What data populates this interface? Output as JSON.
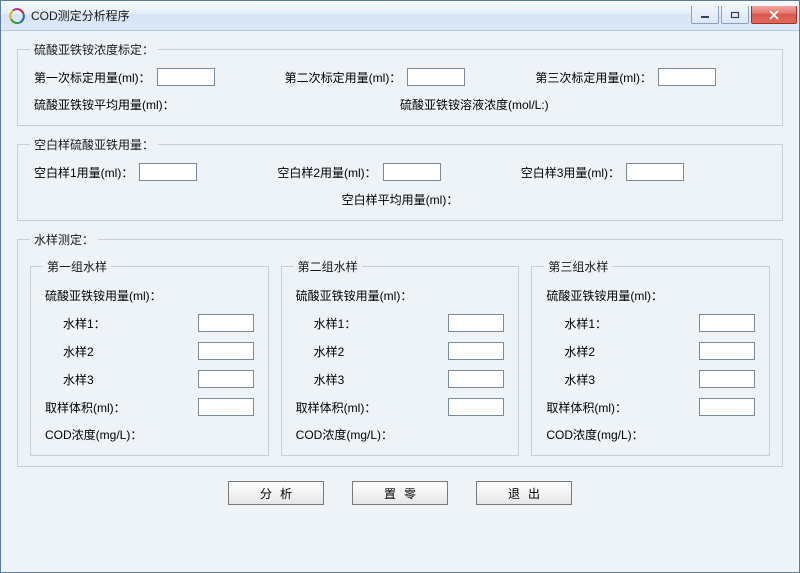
{
  "window": {
    "title": "COD测定分析程序"
  },
  "calibration": {
    "legend": "硫酸亚铁铵浓度标定：",
    "cal1_label": "第一次标定用量(ml)：",
    "cal1_value": "",
    "cal2_label": "第二次标定用量(ml)：",
    "cal2_value": "",
    "cal3_label": "第三次标定用量(ml)：",
    "cal3_value": "",
    "avg_label": "硫酸亚铁铵平均用量(ml)：",
    "conc_label": "硫酸亚铁铵溶液浓度(mol/L:)"
  },
  "blank": {
    "legend": "空白样硫酸亚铁用量：",
    "b1_label": "空白样1用量(ml)：",
    "b1_value": "",
    "b2_label": "空白样2用量(ml)：",
    "b2_value": "",
    "b3_label": "空白样3用量(ml)：",
    "b3_value": "",
    "avg_label": "空白样平均用量(ml)："
  },
  "samples": {
    "outer_legend": "水样测定：",
    "fe_label": "硫酸亚铁铵用量(ml)：",
    "s1": "水样1：",
    "s2": "水样2",
    "s3": "水样3",
    "vol_label": "取样体积(ml)：",
    "cod_label": "COD浓度(mg/L)：",
    "g1": {
      "legend": "第一组水样",
      "v1": "",
      "v2": "",
      "v3": "",
      "vol": ""
    },
    "g2": {
      "legend": "第二组水样",
      "v1": "",
      "v2": "",
      "v3": "",
      "vol": ""
    },
    "g3": {
      "legend": "第三组水样",
      "v1": "",
      "v2": "",
      "v3": "",
      "vol": ""
    }
  },
  "buttons": {
    "analyze": "分析",
    "reset": "置零",
    "exit": "退出"
  }
}
